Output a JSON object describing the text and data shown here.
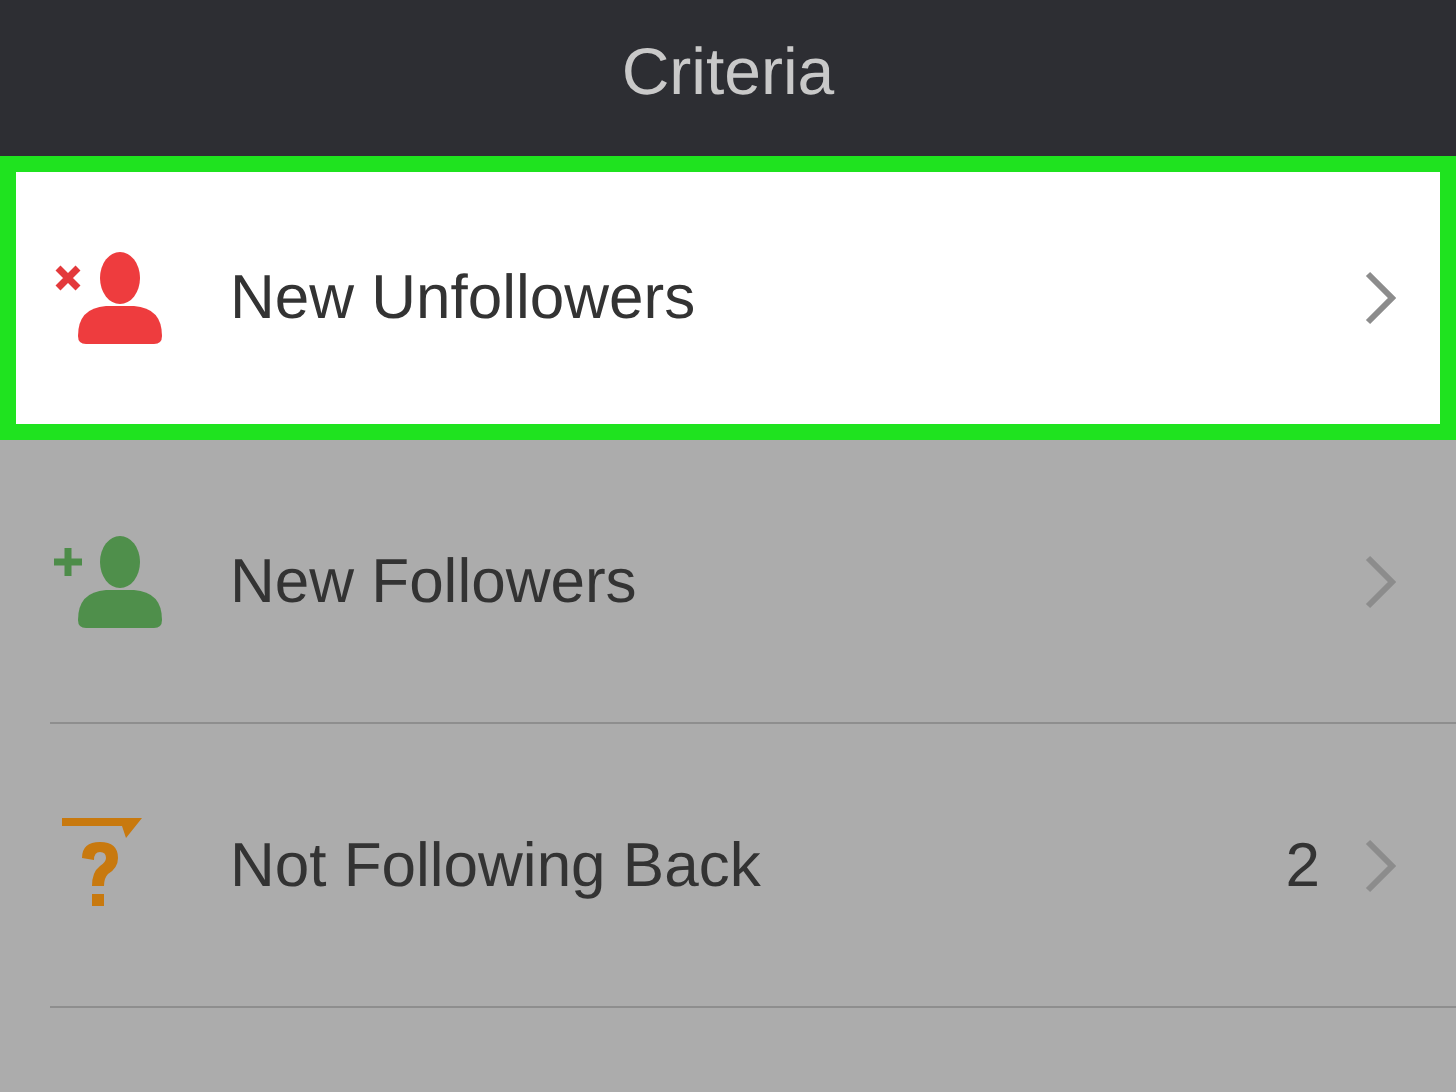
{
  "header": {
    "title": "Criteria"
  },
  "items": [
    {
      "kind": "unfollowers",
      "label": "New Unfollowers",
      "selected": true
    },
    {
      "kind": "followers",
      "label": "New Followers",
      "selected": false
    },
    {
      "kind": "not-following-back",
      "label": "Not Following Back",
      "count": "2",
      "selected": false
    }
  ]
}
